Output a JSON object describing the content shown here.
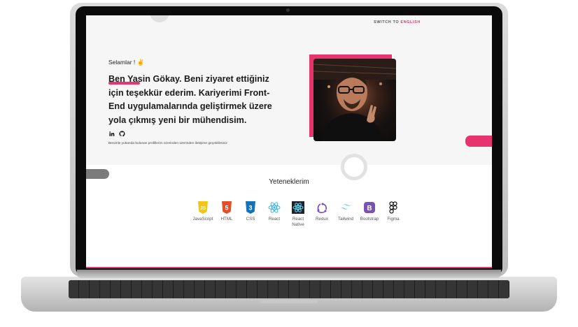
{
  "header": {
    "switch_prefix": "SWITCH TO ",
    "switch_lang": "ENGLISH"
  },
  "hero": {
    "greeting": "Selamlar !",
    "wave": "✌",
    "intro": "Ben Yasin Gökay. Beni ziyaret ettiğiniz için teşekkür ederim. Kariyerimi Front-End uygulamalarında geliştirmek üzere yola çıkmış yeni bir mühendisim.",
    "note": "Benimle yukarıda bulunan profillerim üzerinden üzerinden iletişime geçebilirsiniz",
    "social_icons": [
      "linkedin-icon",
      "github-icon"
    ]
  },
  "skills": {
    "title": "Yeteneklerim",
    "items": [
      {
        "label": "JavaScript",
        "icon": "javascript-icon"
      },
      {
        "label": "HTML",
        "icon": "html-icon"
      },
      {
        "label": "CSS",
        "icon": "css-icon"
      },
      {
        "label": "React",
        "icon": "react-icon"
      },
      {
        "label": "React Native",
        "icon": "react-native-icon"
      },
      {
        "label": "Redux",
        "icon": "redux-icon"
      },
      {
        "label": "Tailwind",
        "icon": "tailwind-icon"
      },
      {
        "label": "Bootstrap",
        "icon": "bootstrap-icon"
      },
      {
        "label": "Figma",
        "icon": "figma-icon"
      }
    ]
  },
  "colors": {
    "accent": "#e8336f",
    "hero_bg": "#f6f6f7"
  }
}
